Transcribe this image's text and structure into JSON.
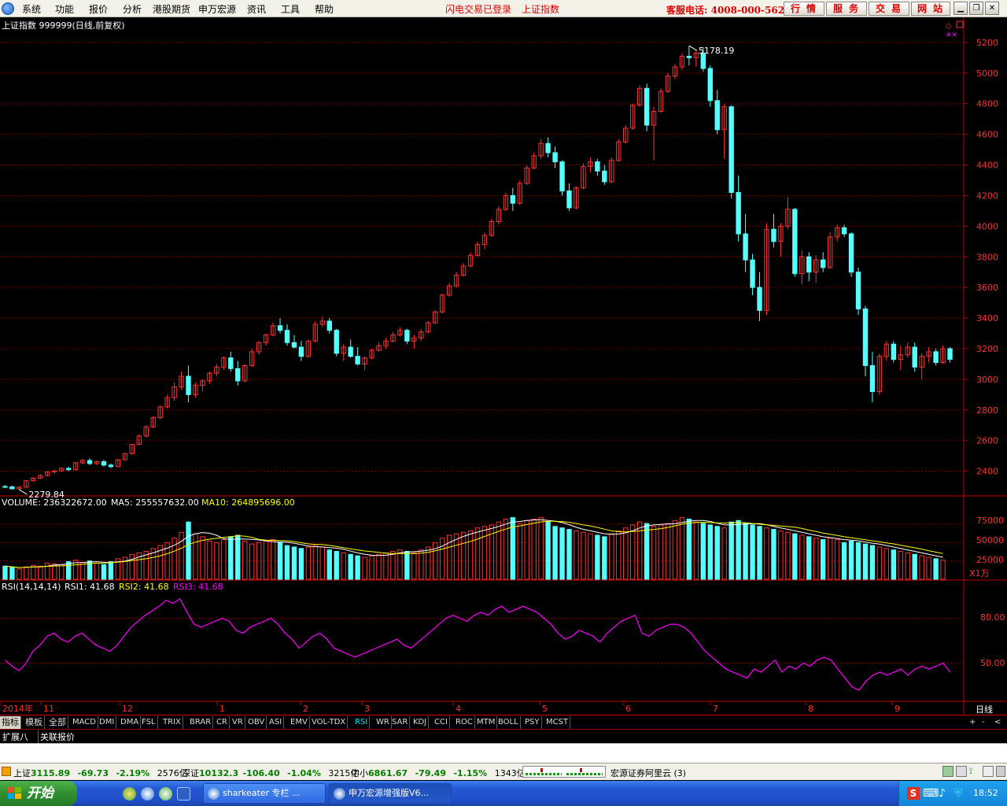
{
  "menubar": {
    "items": [
      "系统",
      "功能",
      "报价",
      "分析",
      "港股期货",
      "申万宏源",
      "资讯",
      "工具",
      "帮助"
    ],
    "status_login": "闪电交易已登录",
    "status_index": "上证指数",
    "hotline": "客服电话: 4008-000-562",
    "buttons": [
      "行情",
      "服务",
      "交易",
      "网站"
    ],
    "window_buttons": [
      "minimize-icon",
      "restore-icon",
      "close-icon"
    ]
  },
  "main_chart": {
    "title": "上证指数 999999(日线,前复权)",
    "high_label": "5178.19",
    "low_label": "2279.84",
    "y_ticks": [
      "5200",
      "5000",
      "4800",
      "4600",
      "4400",
      "4200",
      "4000",
      "3800",
      "3600",
      "3400",
      "3200",
      "3000",
      "2800",
      "2600",
      "2400"
    ]
  },
  "volume_panel": {
    "header_volume": "VOLUME: 236322672.00",
    "header_ma5": "MA5: 255557632.00",
    "header_ma10": "MA10: 264895696.00",
    "y_ticks": [
      "75000",
      "50000",
      "25000"
    ],
    "unit": "X1万"
  },
  "rsi_panel": {
    "header_name": "RSI(14,14,14)",
    "rsi1": "RSI1: 41.68",
    "rsi2": "RSI2: 41.68",
    "rsi3": "RSI3: 41.68",
    "y_ticks": [
      "80.00",
      "50.00"
    ]
  },
  "time_axis": {
    "labels": [
      "2014年",
      "11",
      "12",
      "1",
      "2",
      "3",
      "4",
      "5",
      "6",
      "7",
      "8",
      "9"
    ],
    "period": "日线"
  },
  "tabs": [
    "指标",
    "模板",
    "全部",
    "MACD",
    "DMI",
    "DMA",
    "FSL",
    "TRIX",
    "BRAR",
    "CR",
    "VR",
    "OBV",
    "ASI",
    "EMV",
    "VOL-TDX",
    "RSI",
    "WR",
    "SAR",
    "KDJ",
    "CCI",
    "ROC",
    "MTM",
    "BOLL",
    "PSY",
    "MCST"
  ],
  "tab_controls": [
    "+",
    "-",
    "<"
  ],
  "ext_tabs": [
    "扩展八",
    "关联报价"
  ],
  "statusbar": {
    "sh_name": "上证",
    "sh_value": "3115.89",
    "sh_change": "-69.73",
    "sh_pct": "-2.19%",
    "sh_amount": "2576亿",
    "sz_name": "深证",
    "sz_value": "10132.3",
    "sz_change": "-106.40",
    "sz_pct": "-1.04%",
    "sz_amount": "3215亿",
    "zx_name": "中小",
    "zx_value": "6861.67",
    "zx_change": "-79.49",
    "zx_pct": "-1.15%",
    "zx_amount": "1343亿",
    "server": "宏源证券阿里云 (3)"
  },
  "taskbar": {
    "start": "开始",
    "tasks": [
      "sharkeater 专栏 ...",
      "申万宏源增强版V6..."
    ],
    "clock": "18:52"
  },
  "colors": {
    "up": "#ff3232",
    "down": "#54ffff",
    "grid": "#8b0000",
    "ma5": "#ffffff",
    "ma10": "#ffff00",
    "rsi": "#ff00ff"
  },
  "chart_data": {
    "type": "candlestick",
    "series_note": "daily candles (open, high, low, close); volume in 万; RSI1",
    "price_ylim": [
      2279.84,
      5178.19
    ],
    "volume_ylim": [
      0,
      90000
    ],
    "rsi_ylim": [
      25,
      95
    ],
    "candles": [
      [
        2300,
        2310,
        2290,
        2298
      ],
      [
        2298,
        2305,
        2282,
        2285
      ],
      [
        2285,
        2300,
        2279.84,
        2296
      ],
      [
        2296,
        2340,
        2294,
        2338
      ],
      [
        2338,
        2360,
        2330,
        2355
      ],
      [
        2355,
        2380,
        2350,
        2372
      ],
      [
        2372,
        2400,
        2365,
        2395
      ],
      [
        2395,
        2410,
        2385,
        2402
      ],
      [
        2402,
        2425,
        2395,
        2418
      ],
      [
        2418,
        2430,
        2400,
        2410
      ],
      [
        2410,
        2460,
        2405,
        2455
      ],
      [
        2455,
        2480,
        2445,
        2470
      ],
      [
        2470,
        2485,
        2440,
        2450
      ],
      [
        2450,
        2470,
        2440,
        2462
      ],
      [
        2462,
        2475,
        2430,
        2440
      ],
      [
        2440,
        2450,
        2420,
        2430
      ],
      [
        2430,
        2480,
        2428,
        2475
      ],
      [
        2475,
        2520,
        2470,
        2515
      ],
      [
        2515,
        2580,
        2510,
        2575
      ],
      [
        2575,
        2640,
        2570,
        2630
      ],
      [
        2630,
        2700,
        2620,
        2690
      ],
      [
        2690,
        2760,
        2680,
        2750
      ],
      [
        2750,
        2830,
        2740,
        2820
      ],
      [
        2820,
        2900,
        2810,
        2880
      ],
      [
        2880,
        2980,
        2860,
        2950
      ],
      [
        2950,
        3050,
        2930,
        3020
      ],
      [
        3020,
        3090,
        2850,
        2900
      ],
      [
        2900,
        2980,
        2880,
        2960
      ],
      [
        2960,
        3000,
        2920,
        2990
      ],
      [
        2990,
        3050,
        2970,
        3040
      ],
      [
        3040,
        3100,
        3020,
        3080
      ],
      [
        3080,
        3150,
        3060,
        3140
      ],
      [
        3140,
        3180,
        3050,
        3070
      ],
      [
        3070,
        3120,
        2960,
        2990
      ],
      [
        2990,
        3100,
        2980,
        3090
      ],
      [
        3090,
        3200,
        3080,
        3180
      ],
      [
        3180,
        3250,
        3160,
        3240
      ],
      [
        3240,
        3300,
        3220,
        3290
      ],
      [
        3290,
        3370,
        3280,
        3350
      ],
      [
        3350,
        3400,
        3300,
        3320
      ],
      [
        3320,
        3360,
        3220,
        3240
      ],
      [
        3240,
        3290,
        3200,
        3210
      ],
      [
        3210,
        3250,
        3120,
        3150
      ],
      [
        3150,
        3260,
        3140,
        3250
      ],
      [
        3250,
        3380,
        3240,
        3360
      ],
      [
        3360,
        3410,
        3340,
        3380
      ],
      [
        3380,
        3400,
        3300,
        3320
      ],
      [
        3320,
        3330,
        3150,
        3170
      ],
      [
        3170,
        3230,
        3120,
        3210
      ],
      [
        3210,
        3260,
        3140,
        3150
      ],
      [
        3150,
        3210,
        3090,
        3100
      ],
      [
        3100,
        3150,
        3060,
        3140
      ],
      [
        3140,
        3200,
        3130,
        3190
      ],
      [
        3190,
        3240,
        3180,
        3220
      ],
      [
        3220,
        3270,
        3200,
        3250
      ],
      [
        3250,
        3310,
        3240,
        3290
      ],
      [
        3290,
        3340,
        3280,
        3320
      ],
      [
        3320,
        3330,
        3230,
        3250
      ],
      [
        3250,
        3290,
        3200,
        3270
      ],
      [
        3270,
        3330,
        3250,
        3310
      ],
      [
        3310,
        3380,
        3300,
        3370
      ],
      [
        3370,
        3450,
        3360,
        3440
      ],
      [
        3440,
        3560,
        3430,
        3550
      ],
      [
        3550,
        3630,
        3540,
        3610
      ],
      [
        3610,
        3700,
        3600,
        3680
      ],
      [
        3680,
        3760,
        3670,
        3740
      ],
      [
        3740,
        3830,
        3730,
        3810
      ],
      [
        3810,
        3900,
        3800,
        3880
      ],
      [
        3880,
        3960,
        3850,
        3940
      ],
      [
        3940,
        4050,
        3930,
        4030
      ],
      [
        4030,
        4130,
        4010,
        4110
      ],
      [
        4110,
        4220,
        4100,
        4200
      ],
      [
        4200,
        4250,
        4100,
        4150
      ],
      [
        4150,
        4300,
        4140,
        4280
      ],
      [
        4280,
        4400,
        4270,
        4380
      ],
      [
        4380,
        4480,
        4370,
        4460
      ],
      [
        4460,
        4570,
        4440,
        4540
      ],
      [
        4540,
        4580,
        4450,
        4480
      ],
      [
        4480,
        4520,
        4380,
        4420
      ],
      [
        4420,
        4430,
        4200,
        4230
      ],
      [
        4230,
        4280,
        4100,
        4120
      ],
      [
        4120,
        4260,
        4110,
        4250
      ],
      [
        4250,
        4410,
        4240,
        4390
      ],
      [
        4390,
        4450,
        4350,
        4420
      ],
      [
        4420,
        4440,
        4330,
        4360
      ],
      [
        4360,
        4400,
        4270,
        4290
      ],
      [
        4290,
        4450,
        4280,
        4430
      ],
      [
        4430,
        4570,
        4420,
        4550
      ],
      [
        4550,
        4660,
        4540,
        4640
      ],
      [
        4640,
        4800,
        4630,
        4790
      ],
      [
        4790,
        4920,
        4780,
        4900
      ],
      [
        4900,
        4930,
        4620,
        4660
      ],
      [
        4660,
        4780,
        4430,
        4750
      ],
      [
        4750,
        4900,
        4740,
        4880
      ],
      [
        4880,
        5000,
        4870,
        4980
      ],
      [
        4980,
        5060,
        4960,
        5040
      ],
      [
        5040,
        5130,
        5020,
        5110
      ],
      [
        5110,
        5178.19,
        5050,
        5100
      ],
      [
        5100,
        5150,
        5040,
        5130
      ],
      [
        5130,
        5170,
        5010,
        5030
      ],
      [
        5030,
        5050,
        4780,
        4820
      ],
      [
        4820,
        4890,
        4600,
        4630
      ],
      [
        4630,
        4800,
        4440,
        4780
      ],
      [
        4780,
        4790,
        4180,
        4220
      ],
      [
        4220,
        4330,
        3900,
        3950
      ],
      [
        3950,
        4080,
        3700,
        3780
      ],
      [
        3780,
        3820,
        3550,
        3600
      ],
      [
        3600,
        3700,
        3380,
        3450
      ],
      [
        3450,
        4020,
        3420,
        3980
      ],
      [
        3980,
        4080,
        3860,
        3900
      ],
      [
        3900,
        4020,
        3800,
        4000
      ],
      [
        4000,
        4190,
        3980,
        4110
      ],
      [
        4110,
        4120,
        3670,
        3690
      ],
      [
        3690,
        3840,
        3620,
        3800
      ],
      [
        3800,
        3830,
        3640,
        3700
      ],
      [
        3700,
        3810,
        3630,
        3780
      ],
      [
        3780,
        3830,
        3700,
        3730
      ],
      [
        3730,
        3960,
        3720,
        3930
      ],
      [
        3930,
        4010,
        3900,
        3990
      ],
      [
        3990,
        4010,
        3930,
        3950
      ],
      [
        3950,
        3960,
        3670,
        3700
      ],
      [
        3700,
        3730,
        3420,
        3460
      ],
      [
        3460,
        3480,
        3020,
        3090
      ],
      [
        3090,
        3180,
        2850,
        2920
      ],
      [
        2920,
        3170,
        2900,
        3150
      ],
      [
        3150,
        3250,
        3120,
        3230
      ],
      [
        3230,
        3250,
        3110,
        3130
      ],
      [
        3130,
        3220,
        3060,
        3160
      ],
      [
        3160,
        3240,
        3140,
        3210
      ],
      [
        3210,
        3240,
        3050,
        3080
      ],
      [
        3080,
        3170,
        3000,
        3150
      ],
      [
        3150,
        3210,
        3110,
        3180
      ],
      [
        3180,
        3200,
        3090,
        3110
      ],
      [
        3110,
        3220,
        3100,
        3200
      ],
      [
        3200,
        3210,
        3110,
        3130
      ]
    ],
    "volume": [
      18000,
      16000,
      14000,
      17000,
      19000,
      18000,
      22000,
      21000,
      20000,
      24000,
      26000,
      23000,
      25000,
      22000,
      20000,
      24000,
      28000,
      30000,
      34000,
      36000,
      38000,
      42000,
      46000,
      50000,
      56000,
      64000,
      78000,
      62000,
      58000,
      52000,
      50000,
      54000,
      58000,
      60000,
      52000,
      48000,
      50000,
      52000,
      54000,
      50000,
      46000,
      44000,
      42000,
      44000,
      46000,
      44000,
      40000,
      38000,
      36000,
      34000,
      32000,
      30000,
      32000,
      34000,
      36000,
      38000,
      40000,
      38000,
      36000,
      40000,
      44000,
      50000,
      56000,
      60000,
      62000,
      64000,
      66000,
      70000,
      72000,
      74000,
      78000,
      82000,
      84000,
      76000,
      80000,
      82000,
      84000,
      78000,
      72000,
      70000,
      68000,
      66000,
      64000,
      62000,
      60000,
      58000,
      62000,
      66000,
      70000,
      74000,
      78000,
      76000,
      72000,
      74000,
      76000,
      80000,
      84000,
      82000,
      78000,
      76000,
      74000,
      72000,
      70000,
      78000,
      80000,
      76000,
      74000,
      72000,
      70000,
      68000,
      66000,
      64000,
      62000,
      60000,
      58000,
      56000,
      54000,
      56000,
      54000,
      50000,
      52000,
      50000,
      48000,
      46000,
      44000,
      42000,
      40000,
      38000,
      36000,
      34000,
      32000,
      30000,
      28000,
      26000
    ],
    "rsi1": [
      52,
      48,
      45,
      50,
      58,
      62,
      68,
      70,
      66,
      64,
      68,
      70,
      66,
      62,
      60,
      58,
      62,
      68,
      74,
      78,
      82,
      85,
      88,
      92,
      90,
      93,
      84,
      76,
      74,
      76,
      78,
      80,
      78,
      72,
      70,
      74,
      76,
      78,
      80,
      76,
      70,
      66,
      60,
      64,
      68,
      70,
      66,
      60,
      58,
      56,
      54,
      56,
      58,
      60,
      62,
      64,
      66,
      62,
      60,
      64,
      68,
      72,
      76,
      80,
      82,
      80,
      78,
      82,
      84,
      82,
      86,
      88,
      84,
      86,
      88,
      86,
      84,
      80,
      76,
      70,
      66,
      68,
      72,
      70,
      68,
      64,
      70,
      74,
      78,
      80,
      82,
      70,
      68,
      72,
      74,
      76,
      76,
      74,
      70,
      64,
      58,
      54,
      50,
      46,
      44,
      42,
      40,
      46,
      44,
      48,
      52,
      44,
      48,
      46,
      50,
      48,
      52,
      54,
      52,
      46,
      40,
      34,
      32,
      38,
      42,
      44,
      42,
      44,
      46,
      42,
      46,
      48,
      46,
      48,
      50,
      44
    ],
    "time_axis_labels": [
      "2014年",
      "11",
      "12",
      "1",
      "2",
      "3",
      "4",
      "5",
      "6",
      "7",
      "8",
      "9"
    ]
  }
}
